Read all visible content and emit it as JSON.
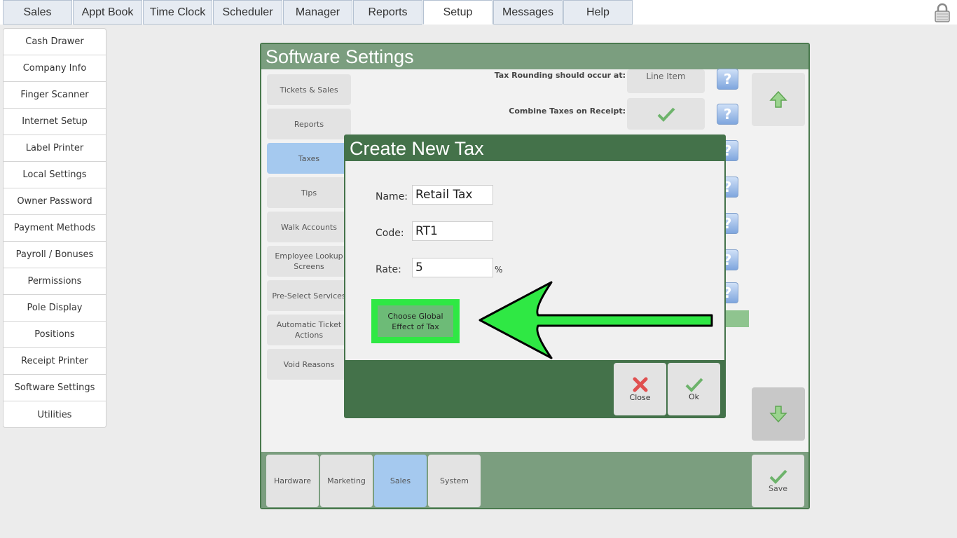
{
  "nav": {
    "tabs": [
      "Sales",
      "Appt Book",
      "Time Clock",
      "Scheduler",
      "Manager",
      "Reports",
      "Setup",
      "Messages",
      "Help"
    ],
    "active": "Setup"
  },
  "sidebar": {
    "items": [
      "Cash Drawer",
      "Company Info",
      "Finger Scanner",
      "Internet Setup",
      "Label Printer",
      "Local Settings",
      "Owner Password",
      "Payment Methods",
      "Payroll / Bonuses",
      "Permissions",
      "Pole Display",
      "Positions",
      "Receipt Printer",
      "Software Settings",
      "Utilities"
    ]
  },
  "settings": {
    "title": "Software Settings",
    "categories": [
      "Tickets & Sales",
      "Reports",
      "Taxes",
      "Tips",
      "Walk Accounts",
      "Employee Lookup Screens",
      "Pre-Select Services",
      "Automatic Ticket Actions",
      "Void Reasons"
    ],
    "active_category": "Taxes",
    "rows": {
      "tax_rounding_label": "Tax Rounding should occur at:",
      "tax_rounding_value": "Line Item",
      "combine_taxes_label": "Combine Taxes on Receipt:"
    },
    "help_glyph": "?",
    "bottom_tabs": [
      "Hardware",
      "Marketing",
      "Sales",
      "System"
    ],
    "active_bottom_tab": "Sales",
    "save_label": "Save"
  },
  "modal": {
    "title": "Create New Tax",
    "name_label": "Name:",
    "name_value": "Retail Tax",
    "code_label": "Code:",
    "code_value": "RT1",
    "rate_label": "Rate:",
    "rate_value": "5",
    "rate_unit": "%",
    "global_effect_label": "Choose Global Effect of Tax",
    "close_label": "Close",
    "ok_label": "Ok"
  },
  "colors": {
    "header_green": "#7b9e7f",
    "modal_green": "#44724a",
    "highlight_green": "#2fe844",
    "selected_blue": "#a5c9ef"
  }
}
